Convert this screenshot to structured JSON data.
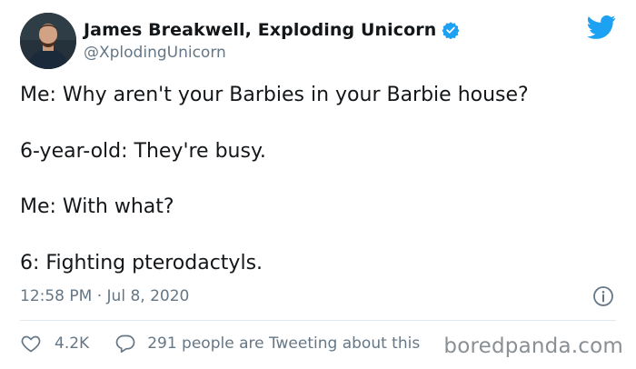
{
  "author": {
    "display_name": "James Breakwell, Exploding Unicorn",
    "handle": "@XplodingUnicorn",
    "verified": true,
    "avatar_icon": "avatar-photo"
  },
  "brand": {
    "icon": "twitter-bird-icon",
    "color": "#1da1f2"
  },
  "tweet": {
    "lines": [
      "Me: Why aren't your Barbies in your Barbie house?",
      "6-year-old: They're busy.",
      "Me: With what?",
      "6: Fighting pterodactyls."
    ],
    "timestamp": "12:58 PM · Jul 8, 2020"
  },
  "actions": {
    "like_count": "4.2K",
    "reply_text": "291 people are Tweeting about this"
  },
  "watermark": "boredpanda.com",
  "colors": {
    "text": "#14171a",
    "secondary": "#657786",
    "divider": "#e1e8ed",
    "verified_badge": "#1da1f2"
  }
}
